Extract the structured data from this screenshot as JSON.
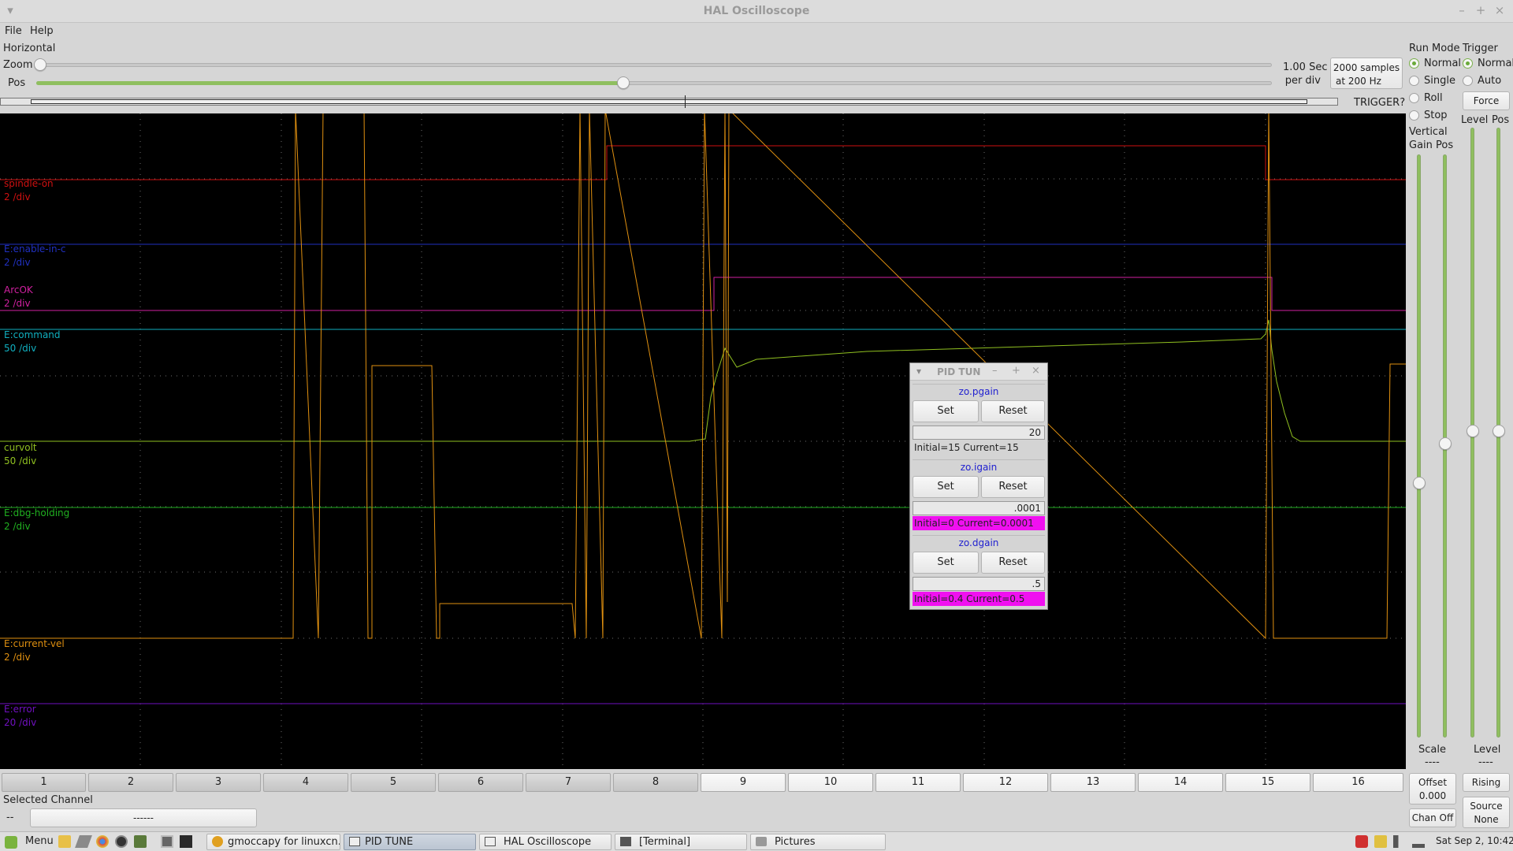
{
  "window": {
    "title": "HAL Oscilloscope"
  },
  "menu": {
    "file": "File",
    "help": "Help"
  },
  "horizontal": {
    "section_label": "Horizontal",
    "zoom_label": "Zoom",
    "pos_label": "Pos",
    "scale_line1": "1.00 Sec",
    "scale_line2": "per div",
    "samples_line1": "2000 samples",
    "samples_line2": "at 200 Hz",
    "trigger_status": "TRIGGER?"
  },
  "run_mode": {
    "label": "Run Mode",
    "options": [
      "Normal",
      "Single",
      "Roll",
      "Stop"
    ],
    "selected": "Normal"
  },
  "trigger": {
    "label": "Trigger",
    "options": [
      "Normal",
      "Auto"
    ],
    "selected": "Normal",
    "force_label": "Force",
    "level_label": "Level",
    "pos_label": "Pos",
    "bottom_label": "Level",
    "bottom_value": "----",
    "edge_button": "Rising",
    "source_label": "Source",
    "source_value": "None"
  },
  "vertical": {
    "label": "Vertical",
    "gain_label": "Gain",
    "pos_label": "Pos",
    "scale_label": "Scale",
    "scale_value": "----",
    "offset_label": "Offset",
    "offset_value": "0.000",
    "chan_off": "Chan Off"
  },
  "channels": [
    {
      "name": "spindle-on",
      "scale": "2 /div",
      "color": "#d01010"
    },
    {
      "name": "E:enable-in-c",
      "scale": "2 /div",
      "color": "#2030c0"
    },
    {
      "name": "ArcOK",
      "scale": "2 /div",
      "color": "#d020a0"
    },
    {
      "name": "E:command",
      "scale": "50 /div",
      "color": "#10b0c0"
    },
    {
      "name": "curvolt",
      "scale": "50 /div",
      "color": "#90c020"
    },
    {
      "name": "E:dbg-holding",
      "scale": "2 /div",
      "color": "#20b020"
    },
    {
      "name": "E:current-vel",
      "scale": "2 /div",
      "color": "#e09010"
    },
    {
      "name": "E:error",
      "scale": "20 /div",
      "color": "#7010c0"
    }
  ],
  "channel_buttons": [
    "1",
    "2",
    "3",
    "4",
    "5",
    "6",
    "7",
    "8",
    "9",
    "10",
    "11",
    "12",
    "13",
    "14",
    "15",
    "16"
  ],
  "selected_channel": {
    "label": "Selected Channel",
    "dash": "--",
    "value": "------"
  },
  "pid_tune": {
    "title": "PID TUN",
    "params": [
      {
        "name": "zo.pgain",
        "set": "Set",
        "reset": "Reset",
        "entry": "20",
        "info": "Initial=15 Current=15",
        "changed": false
      },
      {
        "name": "zo.igain",
        "set": "Set",
        "reset": "Reset",
        "entry": ".0001",
        "info": "Initial=0 Current=0.0001",
        "changed": true
      },
      {
        "name": "zo.dgain",
        "set": "Set",
        "reset": "Reset",
        "entry": ".5",
        "info": "Initial=0.4 Current=0.5",
        "changed": true
      }
    ],
    "changed_color": "#f010f0"
  },
  "taskbar": {
    "menu": "Menu",
    "tasks": [
      "gmoccapy for linuxcn...",
      "PID TUNE",
      "HAL Oscilloscope",
      "[Terminal]",
      "Pictures"
    ],
    "active": "PID TUNE",
    "clock": "Sat Sep 2, 10:42"
  }
}
